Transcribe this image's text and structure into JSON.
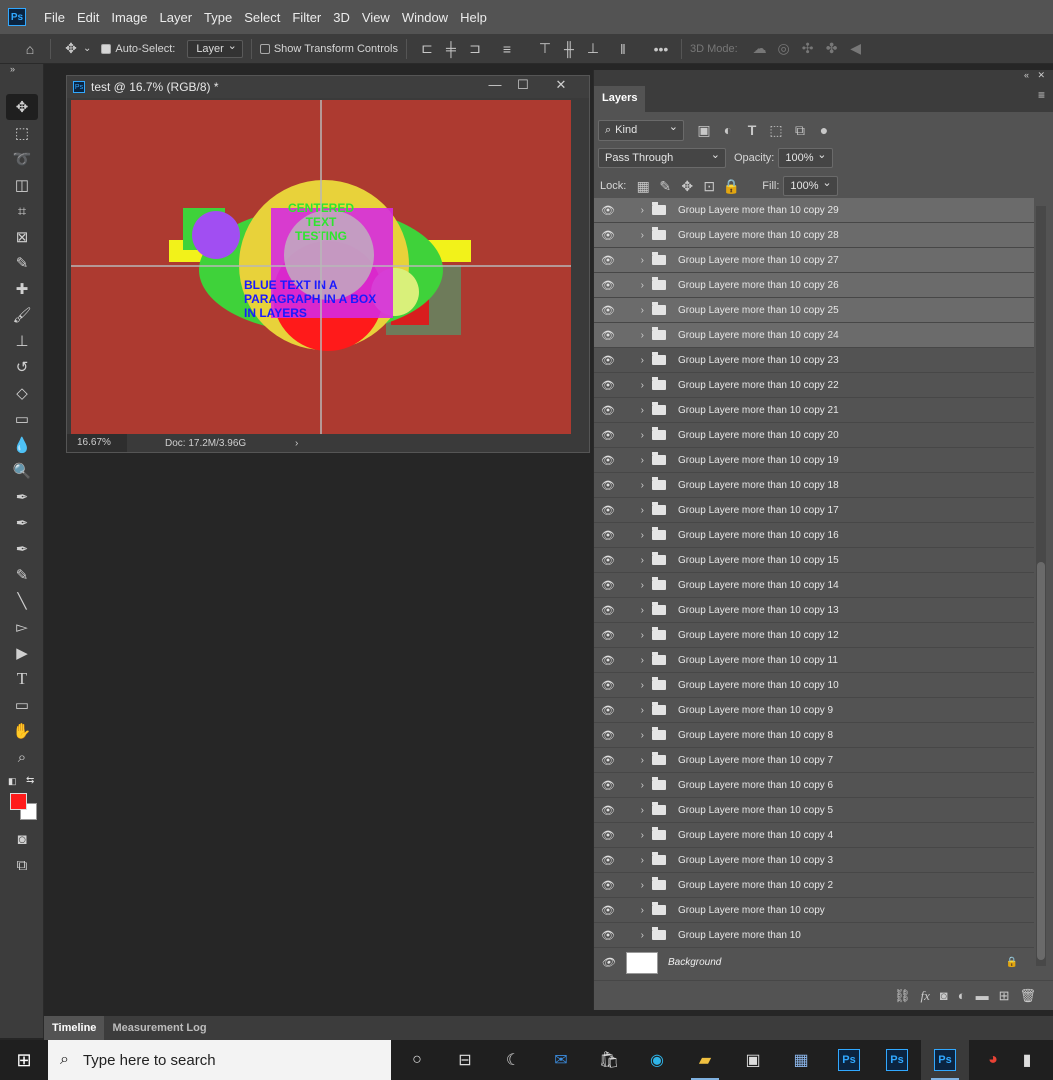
{
  "menubar": {
    "logo": "Ps",
    "items": [
      "File",
      "Edit",
      "Image",
      "Layer",
      "Type",
      "Select",
      "Filter",
      "3D",
      "View",
      "Window",
      "Help"
    ]
  },
  "options": {
    "auto_select_label": "Auto-Select:",
    "auto_select_target": "Layer",
    "transform_controls_label": "Show Transform Controls",
    "mode_3d_label": "3D Mode:"
  },
  "document": {
    "title": "test @ 16.7% (RGB/8) *",
    "zoom": "16.67%",
    "doc_size": "Doc: 17.2M/3.96G",
    "artwork": {
      "centered_text": [
        "CENTERED",
        "TEXT",
        "TESTING"
      ],
      "blue_text": [
        "BLUE TEXT IN A",
        "PARAGRAPH IN A BOX",
        "IN LAYERS"
      ],
      "canvas_color": "#ad3a30"
    }
  },
  "layers_panel": {
    "tab": "Layers",
    "filter_kind": "Kind",
    "blend_mode": "Pass Through",
    "opacity_label": "Opacity:",
    "opacity_value": "100%",
    "lock_label": "Lock:",
    "fill_label": "Fill:",
    "fill_value": "100%",
    "layers": [
      {
        "name": "Group Layere more than 10 copy 29",
        "selected": true
      },
      {
        "name": "Group Layere more than 10 copy 28",
        "selected": true
      },
      {
        "name": "Group Layere more than 10 copy 27",
        "selected": true
      },
      {
        "name": "Group Layere more than 10 copy 26",
        "selected": true
      },
      {
        "name": "Group Layere more than 10 copy 25",
        "selected": true
      },
      {
        "name": "Group Layere more than 10 copy 24",
        "selected": true
      },
      {
        "name": "Group Layere more than 10 copy 23",
        "selected": false
      },
      {
        "name": "Group Layere more than 10 copy 22",
        "selected": false
      },
      {
        "name": "Group Layere more than 10 copy 21",
        "selected": false
      },
      {
        "name": "Group Layere more than 10 copy 20",
        "selected": false
      },
      {
        "name": "Group Layere more than 10 copy 19",
        "selected": false
      },
      {
        "name": "Group Layere more than 10 copy 18",
        "selected": false
      },
      {
        "name": "Group Layere more than 10 copy 17",
        "selected": false
      },
      {
        "name": "Group Layere more than 10 copy 16",
        "selected": false
      },
      {
        "name": "Group Layere more than 10 copy 15",
        "selected": false
      },
      {
        "name": "Group Layere more than 10 copy 14",
        "selected": false
      },
      {
        "name": "Group Layere more than 10 copy 13",
        "selected": false
      },
      {
        "name": "Group Layere more than 10 copy 12",
        "selected": false
      },
      {
        "name": "Group Layere more than 10 copy 11",
        "selected": false
      },
      {
        "name": "Group Layere more than 10 copy 10",
        "selected": false
      },
      {
        "name": "Group Layere more than 10 copy 9",
        "selected": false
      },
      {
        "name": "Group Layere more than 10 copy 8",
        "selected": false
      },
      {
        "name": "Group Layere more than 10 copy 7",
        "selected": false
      },
      {
        "name": "Group Layere more than 10 copy 6",
        "selected": false
      },
      {
        "name": "Group Layere more than 10 copy 5",
        "selected": false
      },
      {
        "name": "Group Layere more than 10 copy 4",
        "selected": false
      },
      {
        "name": "Group Layere more than 10 copy 3",
        "selected": false
      },
      {
        "name": "Group Layere more than 10 copy 2",
        "selected": false
      },
      {
        "name": "Group Layere more than 10 copy",
        "selected": false
      },
      {
        "name": "Group Layere more than 10",
        "selected": false
      }
    ],
    "background_layer": "Background"
  },
  "bottom_tabs": [
    "Timeline",
    "Measurement Log"
  ],
  "taskbar": {
    "search_placeholder": "Type here to search",
    "ps_label": "Ps"
  }
}
